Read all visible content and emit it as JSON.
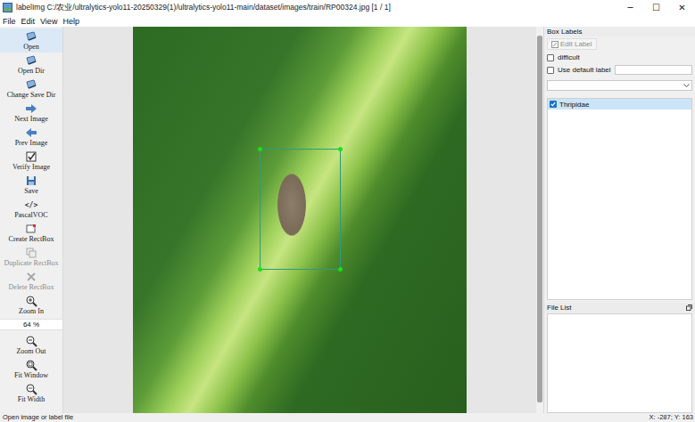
{
  "window": {
    "title": "labelImg C:/农业/ultralytics-yolo11-20250329(1)/ultralytics-yolo11-main/dataset/images/train/RP00324.jpg [1 / 1]",
    "controls": [
      "─",
      "☐",
      "✕"
    ]
  },
  "menu": [
    "File",
    "Edit",
    "View",
    "Help"
  ],
  "toolbar": [
    {
      "label": "Open",
      "kind": "button",
      "disabled": false,
      "selected": true
    },
    {
      "label": "Open Dir",
      "kind": "button",
      "disabled": false,
      "selected": false
    },
    {
      "label": "Change Save Dir",
      "kind": "button",
      "disabled": false,
      "selected": false
    },
    {
      "label": "Next Image",
      "kind": "button",
      "disabled": false,
      "selected": false
    },
    {
      "label": "Prev Image",
      "kind": "button",
      "disabled": false,
      "selected": false
    },
    {
      "label": "Verify Image",
      "kind": "button",
      "disabled": false,
      "selected": false
    },
    {
      "label": "Save",
      "kind": "button",
      "disabled": false,
      "selected": false
    },
    {
      "label": "PascalVOC",
      "kind": "button",
      "glyph": "</>",
      "disabled": false,
      "selected": false
    },
    {
      "label": "Create RectBox",
      "kind": "button",
      "disabled": false,
      "selected": false
    },
    {
      "label": "Duplicate RectBox",
      "kind": "button",
      "disabled": true,
      "selected": false
    },
    {
      "label": "Delete RectBox",
      "kind": "button",
      "disabled": true,
      "selected": false
    },
    {
      "label": "Zoom In",
      "kind": "button",
      "disabled": false,
      "selected": false
    },
    {
      "label": "64 %",
      "kind": "field",
      "disabled": false,
      "selected": false
    },
    {
      "label": "Zoom Out",
      "kind": "button",
      "disabled": false,
      "selected": false
    },
    {
      "label": "Fit Window",
      "kind": "button",
      "disabled": false,
      "selected": false
    },
    {
      "label": "Fit Width",
      "kind": "button",
      "disabled": false,
      "selected": false
    }
  ],
  "box_labels": {
    "title": "Box Labels",
    "edit_label": {
      "label": "Edit Label",
      "disabled": true
    },
    "difficult": {
      "label": "difficult",
      "checked": false
    },
    "default_label": {
      "label": "Use default label",
      "checked": false,
      "value": ""
    },
    "combo": {
      "value": ""
    },
    "labels": [
      {
        "name": "Thripidae",
        "checked": true,
        "selected": true
      }
    ]
  },
  "file_list": {
    "title": "File List",
    "files": []
  },
  "status_bar": {
    "message": "Open image or label file",
    "coords": "X: -287; Y: 163"
  }
}
